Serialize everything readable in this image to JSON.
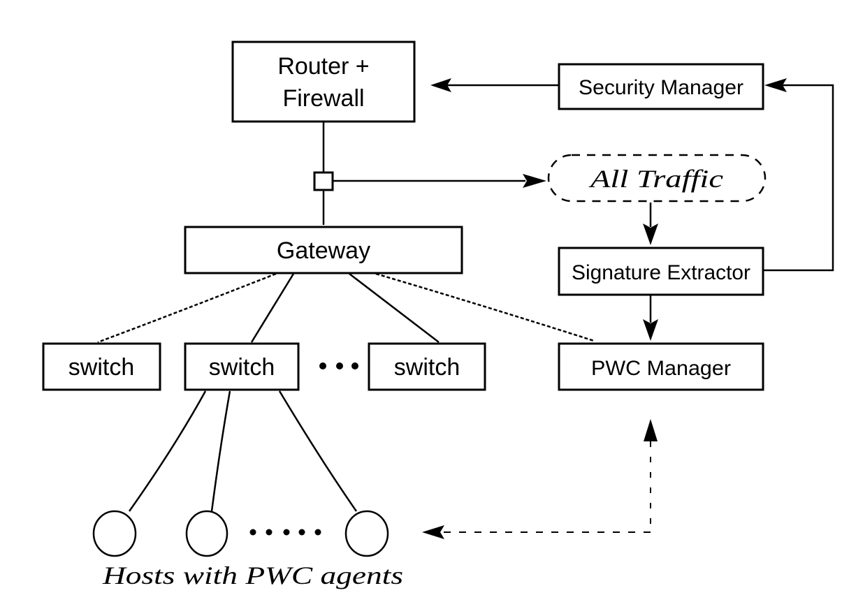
{
  "diagram": {
    "nodes": {
      "router": {
        "line1": "Router +",
        "line2": "Firewall"
      },
      "security_manager": {
        "label": "Security Manager"
      },
      "all_traffic": {
        "label": "All Traffic"
      },
      "gateway": {
        "label": "Gateway"
      },
      "signature_extractor": {
        "label": "Signature Extractor"
      },
      "switches": [
        {
          "label": "switch"
        },
        {
          "label": "switch"
        },
        {
          "label": "switch"
        }
      ],
      "pwc_manager": {
        "label": "PWC Manager"
      },
      "hosts_caption": {
        "label": "Hosts with PWC agents"
      }
    },
    "edges": [
      {
        "from": "security_manager",
        "to": "router",
        "style": "solid",
        "arrow": "to"
      },
      {
        "from": "signature_extractor",
        "to": "security_manager",
        "style": "solid",
        "arrow": "to"
      },
      {
        "from": "router",
        "to": "gateway",
        "style": "solid",
        "arrow": "none"
      },
      {
        "from": "tap",
        "to": "all_traffic",
        "style": "solid",
        "arrow": "to"
      },
      {
        "from": "all_traffic",
        "to": "signature_extractor",
        "style": "solid",
        "arrow": "to"
      },
      {
        "from": "signature_extractor",
        "to": "pwc_manager",
        "style": "solid",
        "arrow": "to"
      },
      {
        "from": "gateway",
        "to": "switch-1",
        "style": "dotted",
        "arrow": "none"
      },
      {
        "from": "gateway",
        "to": "switch-2",
        "style": "solid",
        "arrow": "none"
      },
      {
        "from": "gateway",
        "to": "switch-3",
        "style": "solid",
        "arrow": "none"
      },
      {
        "from": "gateway",
        "to": "pwc_manager",
        "style": "dotted",
        "arrow": "none"
      },
      {
        "from": "switch-2",
        "to": "hosts",
        "style": "solid",
        "arrow": "none"
      },
      {
        "from": "pwc_manager",
        "to": "hosts",
        "style": "dashed",
        "arrow": "both"
      }
    ]
  }
}
